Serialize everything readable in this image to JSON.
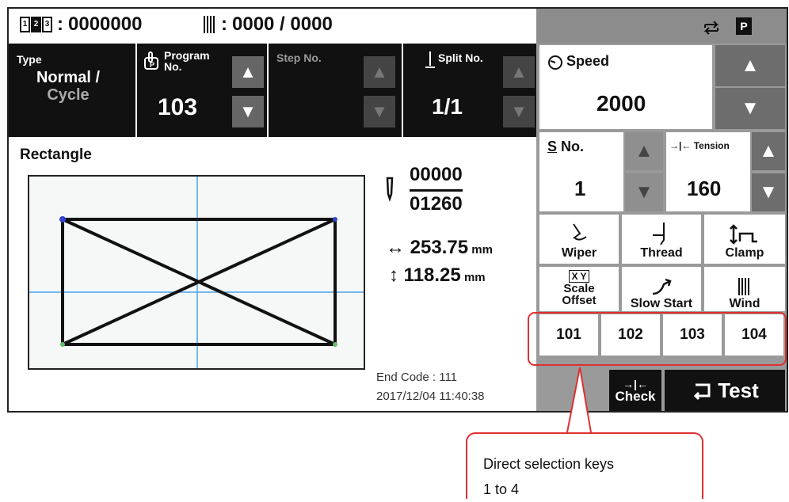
{
  "status": {
    "counter_value": "0000000",
    "counter_icon_digits": [
      "1",
      "2",
      "3"
    ],
    "bobbin_value": "0000 / 0000",
    "sync_icon": "repeat-icon",
    "p_icon": "P"
  },
  "type": {
    "label": "Type",
    "value_line1": "Normal /",
    "value_line2": "Cycle"
  },
  "program": {
    "label_line1": "Program",
    "label_line2": "No.",
    "value": "103"
  },
  "step": {
    "label": "Step No."
  },
  "split": {
    "label": "Split No.",
    "value": "1/1"
  },
  "speed": {
    "label": "Speed",
    "value": "2000"
  },
  "sno": {
    "label_s": "S",
    "label": "No.",
    "value": "1"
  },
  "tension": {
    "label": "Tension",
    "value": "160"
  },
  "pattern": {
    "name": "Rectangle"
  },
  "needle": {
    "current": "00000",
    "total": "01260"
  },
  "dimensions": {
    "width_value": "253.75",
    "width_unit": "mm",
    "height_value": "118.25",
    "height_unit": "mm"
  },
  "end_code": {
    "text": "End Code : 111"
  },
  "timestamp": {
    "text": "2017/12/04 11:40:38"
  },
  "func_buttons": {
    "wiper": "Wiper",
    "thread": "Thread",
    "clamp": "Clamp",
    "scale_line1": "Scale",
    "scale_line2": "Offset",
    "scale_icon": "X Y",
    "slow_start": "Slow Start",
    "wind": "Wind"
  },
  "direct_keys": [
    "101",
    "102",
    "103",
    "104"
  ],
  "check_label": "Check",
  "test_label": "Test",
  "callout": {
    "line1": "Direct selection keys",
    "line2": "1 to 4"
  },
  "colors": {
    "accent_red": "#e03030",
    "panel_dark": "#111111",
    "panel_grey": "#9a9a9a"
  }
}
